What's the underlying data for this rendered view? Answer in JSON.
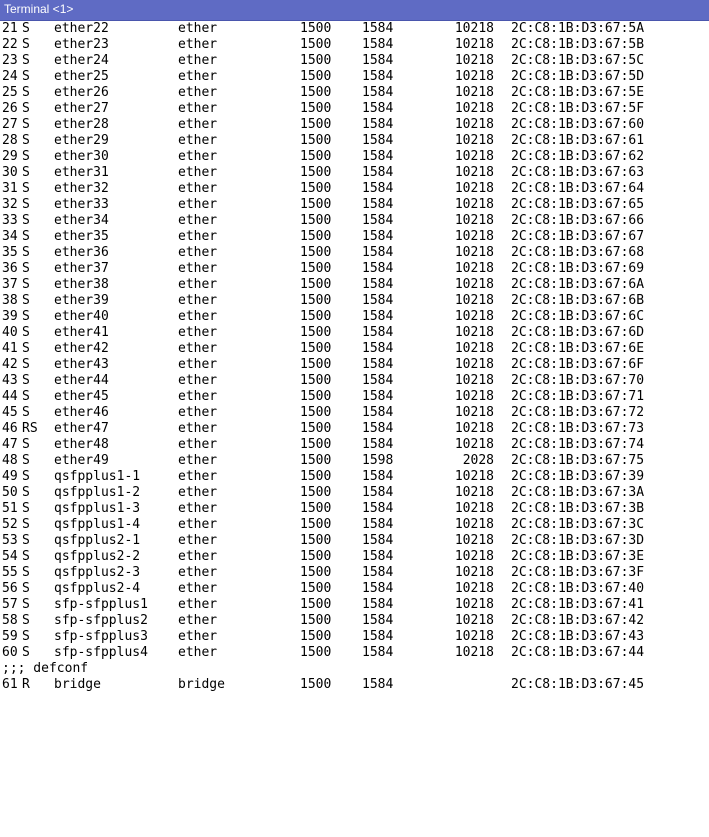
{
  "window": {
    "title": "Terminal <1>"
  },
  "rows": [
    {
      "num": "21",
      "flags": "S",
      "name": "ether22",
      "type": "ether",
      "mtu": "1500",
      "l2mtu": "1584",
      "max_l2mtu": "10218",
      "mac": "2C:C8:1B:D3:67:5A"
    },
    {
      "num": "22",
      "flags": "S",
      "name": "ether23",
      "type": "ether",
      "mtu": "1500",
      "l2mtu": "1584",
      "max_l2mtu": "10218",
      "mac": "2C:C8:1B:D3:67:5B"
    },
    {
      "num": "23",
      "flags": "S",
      "name": "ether24",
      "type": "ether",
      "mtu": "1500",
      "l2mtu": "1584",
      "max_l2mtu": "10218",
      "mac": "2C:C8:1B:D3:67:5C"
    },
    {
      "num": "24",
      "flags": "S",
      "name": "ether25",
      "type": "ether",
      "mtu": "1500",
      "l2mtu": "1584",
      "max_l2mtu": "10218",
      "mac": "2C:C8:1B:D3:67:5D"
    },
    {
      "num": "25",
      "flags": "S",
      "name": "ether26",
      "type": "ether",
      "mtu": "1500",
      "l2mtu": "1584",
      "max_l2mtu": "10218",
      "mac": "2C:C8:1B:D3:67:5E"
    },
    {
      "num": "26",
      "flags": "S",
      "name": "ether27",
      "type": "ether",
      "mtu": "1500",
      "l2mtu": "1584",
      "max_l2mtu": "10218",
      "mac": "2C:C8:1B:D3:67:5F"
    },
    {
      "num": "27",
      "flags": "S",
      "name": "ether28",
      "type": "ether",
      "mtu": "1500",
      "l2mtu": "1584",
      "max_l2mtu": "10218",
      "mac": "2C:C8:1B:D3:67:60"
    },
    {
      "num": "28",
      "flags": "S",
      "name": "ether29",
      "type": "ether",
      "mtu": "1500",
      "l2mtu": "1584",
      "max_l2mtu": "10218",
      "mac": "2C:C8:1B:D3:67:61"
    },
    {
      "num": "29",
      "flags": "S",
      "name": "ether30",
      "type": "ether",
      "mtu": "1500",
      "l2mtu": "1584",
      "max_l2mtu": "10218",
      "mac": "2C:C8:1B:D3:67:62"
    },
    {
      "num": "30",
      "flags": "S",
      "name": "ether31",
      "type": "ether",
      "mtu": "1500",
      "l2mtu": "1584",
      "max_l2mtu": "10218",
      "mac": "2C:C8:1B:D3:67:63"
    },
    {
      "num": "31",
      "flags": "S",
      "name": "ether32",
      "type": "ether",
      "mtu": "1500",
      "l2mtu": "1584",
      "max_l2mtu": "10218",
      "mac": "2C:C8:1B:D3:67:64"
    },
    {
      "num": "32",
      "flags": "S",
      "name": "ether33",
      "type": "ether",
      "mtu": "1500",
      "l2mtu": "1584",
      "max_l2mtu": "10218",
      "mac": "2C:C8:1B:D3:67:65"
    },
    {
      "num": "33",
      "flags": "S",
      "name": "ether34",
      "type": "ether",
      "mtu": "1500",
      "l2mtu": "1584",
      "max_l2mtu": "10218",
      "mac": "2C:C8:1B:D3:67:66"
    },
    {
      "num": "34",
      "flags": "S",
      "name": "ether35",
      "type": "ether",
      "mtu": "1500",
      "l2mtu": "1584",
      "max_l2mtu": "10218",
      "mac": "2C:C8:1B:D3:67:67"
    },
    {
      "num": "35",
      "flags": "S",
      "name": "ether36",
      "type": "ether",
      "mtu": "1500",
      "l2mtu": "1584",
      "max_l2mtu": "10218",
      "mac": "2C:C8:1B:D3:67:68"
    },
    {
      "num": "36",
      "flags": "S",
      "name": "ether37",
      "type": "ether",
      "mtu": "1500",
      "l2mtu": "1584",
      "max_l2mtu": "10218",
      "mac": "2C:C8:1B:D3:67:69"
    },
    {
      "num": "37",
      "flags": "S",
      "name": "ether38",
      "type": "ether",
      "mtu": "1500",
      "l2mtu": "1584",
      "max_l2mtu": "10218",
      "mac": "2C:C8:1B:D3:67:6A"
    },
    {
      "num": "38",
      "flags": "S",
      "name": "ether39",
      "type": "ether",
      "mtu": "1500",
      "l2mtu": "1584",
      "max_l2mtu": "10218",
      "mac": "2C:C8:1B:D3:67:6B"
    },
    {
      "num": "39",
      "flags": "S",
      "name": "ether40",
      "type": "ether",
      "mtu": "1500",
      "l2mtu": "1584",
      "max_l2mtu": "10218",
      "mac": "2C:C8:1B:D3:67:6C"
    },
    {
      "num": "40",
      "flags": "S",
      "name": "ether41",
      "type": "ether",
      "mtu": "1500",
      "l2mtu": "1584",
      "max_l2mtu": "10218",
      "mac": "2C:C8:1B:D3:67:6D"
    },
    {
      "num": "41",
      "flags": "S",
      "name": "ether42",
      "type": "ether",
      "mtu": "1500",
      "l2mtu": "1584",
      "max_l2mtu": "10218",
      "mac": "2C:C8:1B:D3:67:6E"
    },
    {
      "num": "42",
      "flags": "S",
      "name": "ether43",
      "type": "ether",
      "mtu": "1500",
      "l2mtu": "1584",
      "max_l2mtu": "10218",
      "mac": "2C:C8:1B:D3:67:6F"
    },
    {
      "num": "43",
      "flags": "S",
      "name": "ether44",
      "type": "ether",
      "mtu": "1500",
      "l2mtu": "1584",
      "max_l2mtu": "10218",
      "mac": "2C:C8:1B:D3:67:70"
    },
    {
      "num": "44",
      "flags": "S",
      "name": "ether45",
      "type": "ether",
      "mtu": "1500",
      "l2mtu": "1584",
      "max_l2mtu": "10218",
      "mac": "2C:C8:1B:D3:67:71"
    },
    {
      "num": "45",
      "flags": "S",
      "name": "ether46",
      "type": "ether",
      "mtu": "1500",
      "l2mtu": "1584",
      "max_l2mtu": "10218",
      "mac": "2C:C8:1B:D3:67:72"
    },
    {
      "num": "46",
      "flags": "RS",
      "name": "ether47",
      "type": "ether",
      "mtu": "1500",
      "l2mtu": "1584",
      "max_l2mtu": "10218",
      "mac": "2C:C8:1B:D3:67:73"
    },
    {
      "num": "47",
      "flags": "S",
      "name": "ether48",
      "type": "ether",
      "mtu": "1500",
      "l2mtu": "1584",
      "max_l2mtu": "10218",
      "mac": "2C:C8:1B:D3:67:74"
    },
    {
      "num": "48",
      "flags": "S",
      "name": "ether49",
      "type": "ether",
      "mtu": "1500",
      "l2mtu": "1598",
      "max_l2mtu": "2028",
      "mac": "2C:C8:1B:D3:67:75"
    },
    {
      "num": "49",
      "flags": "S",
      "name": "qsfpplus1-1",
      "type": "ether",
      "mtu": "1500",
      "l2mtu": "1584",
      "max_l2mtu": "10218",
      "mac": "2C:C8:1B:D3:67:39"
    },
    {
      "num": "50",
      "flags": "S",
      "name": "qsfpplus1-2",
      "type": "ether",
      "mtu": "1500",
      "l2mtu": "1584",
      "max_l2mtu": "10218",
      "mac": "2C:C8:1B:D3:67:3A"
    },
    {
      "num": "51",
      "flags": "S",
      "name": "qsfpplus1-3",
      "type": "ether",
      "mtu": "1500",
      "l2mtu": "1584",
      "max_l2mtu": "10218",
      "mac": "2C:C8:1B:D3:67:3B"
    },
    {
      "num": "52",
      "flags": "S",
      "name": "qsfpplus1-4",
      "type": "ether",
      "mtu": "1500",
      "l2mtu": "1584",
      "max_l2mtu": "10218",
      "mac": "2C:C8:1B:D3:67:3C"
    },
    {
      "num": "53",
      "flags": "S",
      "name": "qsfpplus2-1",
      "type": "ether",
      "mtu": "1500",
      "l2mtu": "1584",
      "max_l2mtu": "10218",
      "mac": "2C:C8:1B:D3:67:3D"
    },
    {
      "num": "54",
      "flags": "S",
      "name": "qsfpplus2-2",
      "type": "ether",
      "mtu": "1500",
      "l2mtu": "1584",
      "max_l2mtu": "10218",
      "mac": "2C:C8:1B:D3:67:3E"
    },
    {
      "num": "55",
      "flags": "S",
      "name": "qsfpplus2-3",
      "type": "ether",
      "mtu": "1500",
      "l2mtu": "1584",
      "max_l2mtu": "10218",
      "mac": "2C:C8:1B:D3:67:3F"
    },
    {
      "num": "56",
      "flags": "S",
      "name": "qsfpplus2-4",
      "type": "ether",
      "mtu": "1500",
      "l2mtu": "1584",
      "max_l2mtu": "10218",
      "mac": "2C:C8:1B:D3:67:40"
    },
    {
      "num": "57",
      "flags": "S",
      "name": "sfp-sfpplus1",
      "type": "ether",
      "mtu": "1500",
      "l2mtu": "1584",
      "max_l2mtu": "10218",
      "mac": "2C:C8:1B:D3:67:41"
    },
    {
      "num": "58",
      "flags": "S",
      "name": "sfp-sfpplus2",
      "type": "ether",
      "mtu": "1500",
      "l2mtu": "1584",
      "max_l2mtu": "10218",
      "mac": "2C:C8:1B:D3:67:42"
    },
    {
      "num": "59",
      "flags": "S",
      "name": "sfp-sfpplus3",
      "type": "ether",
      "mtu": "1500",
      "l2mtu": "1584",
      "max_l2mtu": "10218",
      "mac": "2C:C8:1B:D3:67:43"
    },
    {
      "num": "60",
      "flags": "S",
      "name": "sfp-sfpplus4",
      "type": "ether",
      "mtu": "1500",
      "l2mtu": "1584",
      "max_l2mtu": "10218",
      "mac": "2C:C8:1B:D3:67:44"
    }
  ],
  "comment": ";;; defconf",
  "bridge_row": {
    "num": "61",
    "flags": "R",
    "name": "bridge",
    "type": "bridge",
    "mtu": "1500",
    "l2mtu": "1584",
    "max_l2mtu": "",
    "mac": "2C:C8:1B:D3:67:45"
  }
}
